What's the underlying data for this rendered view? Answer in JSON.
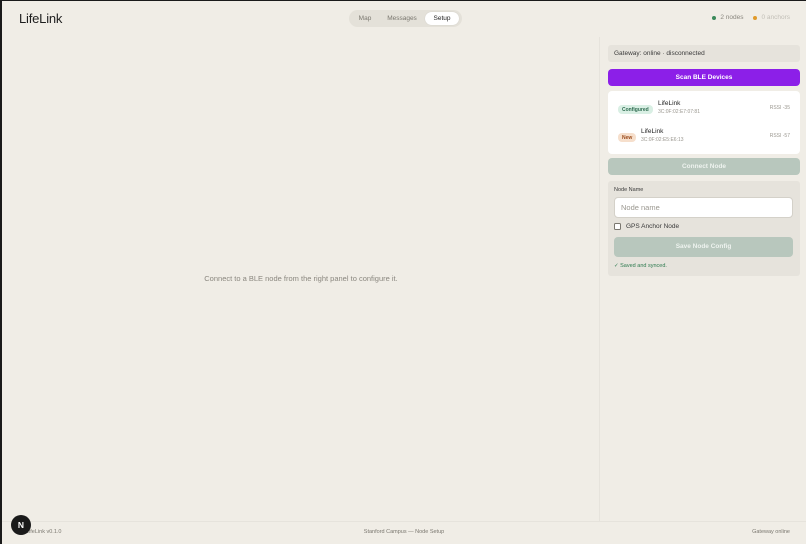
{
  "app": {
    "title": "LifeLink"
  },
  "tabs": [
    {
      "label": "Map"
    },
    {
      "label": "Messages"
    },
    {
      "label": "Setup",
      "active": true
    }
  ],
  "stats": {
    "nodes": "2 nodes",
    "anchors": "0 anchors",
    "nodes_dot_color": "#3b8a5a",
    "anchors_dot_color": "#e09a2a"
  },
  "main": {
    "empty_message": "Connect to a BLE node from the right panel to configure it."
  },
  "panel": {
    "gateway_status": "Gateway: online · disconnected",
    "scan_button": "Scan BLE Devices",
    "devices": [
      {
        "badge": "Configured",
        "name": "LifeLink",
        "mac": "3C:0F:02:E7:07:81",
        "rssi": "RSSI -35"
      },
      {
        "badge": "New",
        "name": "LifeLink",
        "mac": "3C:0F:02:E5:E6:13",
        "rssi": "RSSI -57"
      }
    ],
    "connect_button": "Connect Node",
    "config": {
      "name_label": "Node Name",
      "name_placeholder": "Node name",
      "anchor_label": "GPS Anchor Node",
      "save_button": "Save Node Config",
      "saved_message": "✓ Saved and synced."
    }
  },
  "footer": {
    "version": "LifeLink v0.1.0",
    "center": "Stanford Campus — Node Setup",
    "right": "Gateway online"
  },
  "fab": {
    "label": "N"
  },
  "colors": {
    "accent": "#8c1fe8",
    "background": "#f0ede6",
    "disabled_button": "#b8c7bd",
    "success": "#2d7a4f"
  }
}
